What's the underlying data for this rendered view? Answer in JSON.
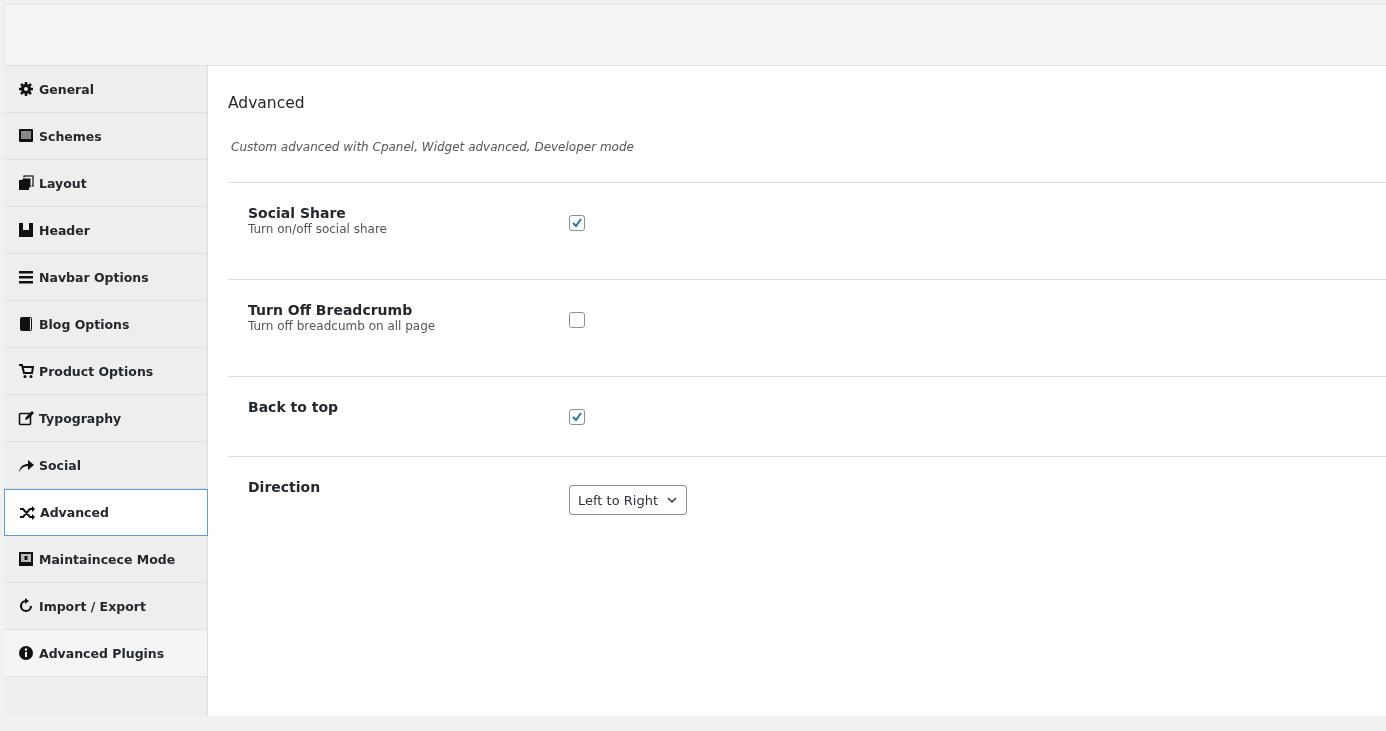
{
  "sidebar": {
    "items": [
      {
        "label": "General",
        "selected": false
      },
      {
        "label": "Schemes",
        "selected": false
      },
      {
        "label": "Layout",
        "selected": false
      },
      {
        "label": "Header",
        "selected": false
      },
      {
        "label": "Navbar Options",
        "selected": false
      },
      {
        "label": "Blog Options",
        "selected": false
      },
      {
        "label": "Product Options",
        "selected": false
      },
      {
        "label": "Typography",
        "selected": false
      },
      {
        "label": "Social",
        "selected": false
      },
      {
        "label": "Advanced",
        "selected": true
      },
      {
        "label": "Maintaincece Mode",
        "selected": false
      },
      {
        "label": "Import / Export",
        "selected": false
      },
      {
        "label": "Advanced Plugins",
        "selected": false
      }
    ]
  },
  "section": {
    "title": "Advanced",
    "description": "Custom advanced with Cpanel, Widget advanced, Developer mode"
  },
  "settings": [
    {
      "kind": "checkbox",
      "label": "Social Share",
      "hint": "Turn on/off social share",
      "checked": true
    },
    {
      "kind": "checkbox",
      "label": "Turn Off Breadcrumb",
      "hint": "Turn off breadcumb on all page",
      "checked": false
    },
    {
      "kind": "checkbox",
      "label": "Back to top",
      "checked": true
    },
    {
      "kind": "select",
      "label": "Direction",
      "value": "Left to Right"
    }
  ]
}
